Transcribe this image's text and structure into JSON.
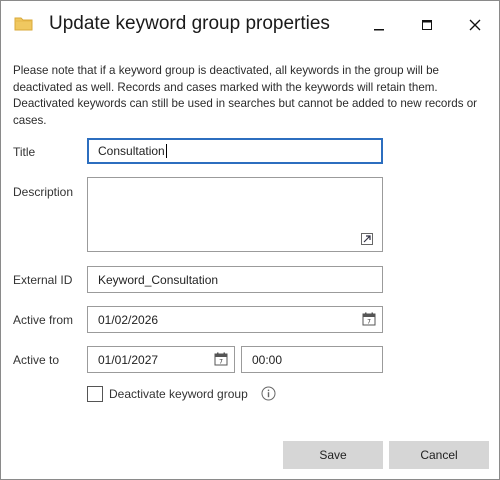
{
  "window": {
    "title": "Update keyword group properties",
    "icons": {
      "app": "folder-icon",
      "minimize": "minimize-icon",
      "maximize": "maximize-icon",
      "close": "close-icon"
    }
  },
  "notice": "Please note that if a keyword group is deactivated, all keywords in the group will be deactivated as well. Records and cases marked with the keywords will retain them. Deactivated keywords can still be used in searches but cannot be added to new records or cases.",
  "form": {
    "title_label": "Title",
    "title_value": "Consultation",
    "description_label": "Description",
    "description_value": "",
    "external_id_label": "External ID",
    "external_id_value": "Keyword_Consultation",
    "active_from_label": "Active from",
    "active_from_value": "01/02/2026",
    "active_to_label": "Active to",
    "active_to_date": "01/01/2027",
    "active_to_time": "00:00",
    "deactivate_label": "Deactivate keyword group",
    "deactivate_checked": false
  },
  "buttons": {
    "save": "Save",
    "cancel": "Cancel"
  },
  "colors": {
    "focus_border": "#2c6ebf",
    "button_bg": "#d6d6d6",
    "field_border": "#9b9b9b"
  }
}
